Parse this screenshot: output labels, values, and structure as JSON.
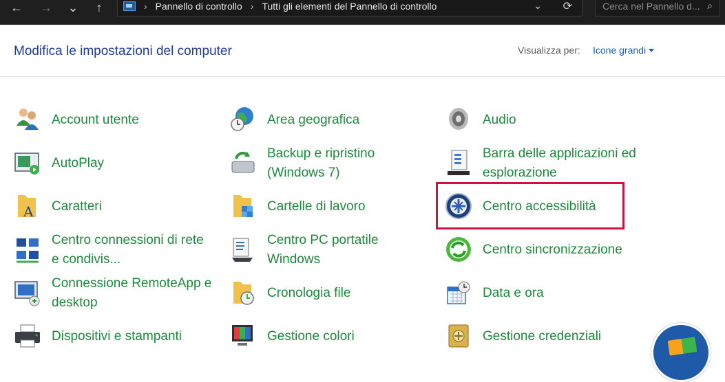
{
  "nav": {
    "back": "←",
    "forward": "→",
    "recent": "⌄",
    "up": "↑"
  },
  "address": {
    "crumbs": [
      "Pannello di controllo",
      "Tutti gli elementi del Pannello di controllo"
    ],
    "separator": "›",
    "dropdown": "⌄",
    "refresh": "⟳"
  },
  "search": {
    "placeholder": "Cerca nel Pannello d...",
    "icon": "⌕"
  },
  "header": {
    "title": "Modifica le impostazioni del computer",
    "view_label": "Visualizza per:",
    "view_value": "Icone grandi"
  },
  "items": [
    {
      "label": "Account utente",
      "icon": "users-icon"
    },
    {
      "label": "Area geografica",
      "icon": "globe-clock-icon"
    },
    {
      "label": "Audio",
      "icon": "speaker-icon"
    },
    {
      "label": "AutoPlay",
      "icon": "autoplay-icon"
    },
    {
      "label": "Backup e ripristino",
      "label2": "(Windows 7)",
      "icon": "backup-icon"
    },
    {
      "label": "Barra delle applicazioni ed",
      "label2": "esplorazione",
      "icon": "taskbar-icon"
    },
    {
      "label": "Caratteri",
      "icon": "fonts-folder-icon"
    },
    {
      "label": "Cartelle di lavoro",
      "icon": "work-folders-icon"
    },
    {
      "label": "Centro accessibilità",
      "icon": "accessibility-icon"
    },
    {
      "label": "Centro connessioni di rete",
      "label2": "e condivis...",
      "icon": "network-icon"
    },
    {
      "label": "Centro PC portatile",
      "label2": "Windows",
      "icon": "mobility-icon"
    },
    {
      "label": "Centro sincronizzazione",
      "icon": "sync-icon"
    },
    {
      "label": "Connessione RemoteApp e",
      "label2": "desktop",
      "icon": "remoteapp-icon"
    },
    {
      "label": "Cronologia file",
      "icon": "file-history-icon"
    },
    {
      "label": "Data e ora",
      "icon": "calendar-clock-icon"
    },
    {
      "label": "Dispositivi e stampanti",
      "icon": "printer-icon"
    },
    {
      "label": "Gestione colori",
      "icon": "color-management-icon"
    },
    {
      "label": "Gestione credenziali",
      "icon": "credential-vault-icon"
    }
  ]
}
